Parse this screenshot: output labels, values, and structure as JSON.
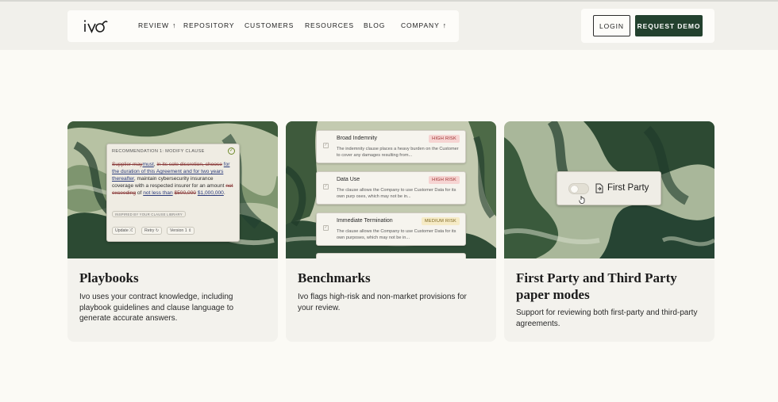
{
  "brand": {
    "logo_text": "ivo"
  },
  "nav": {
    "items": [
      {
        "label": "REVIEW",
        "has_arrow": true
      },
      {
        "label": "REPOSITORY",
        "has_arrow": false
      },
      {
        "label": "CUSTOMERS",
        "has_arrow": false
      },
      {
        "label": "RESOURCES",
        "has_arrow": false
      },
      {
        "label": "BLOG",
        "has_arrow": false
      },
      {
        "label": "COMPANY",
        "has_arrow": true
      }
    ],
    "arrow_glyph": "↑",
    "login_label": "LOGIN",
    "demo_label": "REQUEST DEMO"
  },
  "colors": {
    "accent_dark_green": "#23412e",
    "page_bg": "#fbfaf5",
    "card_bg": "#f3f2ed",
    "high_risk": "#9b2b2b",
    "medium_risk": "#7a6320"
  },
  "cards": [
    {
      "title": "Playbooks",
      "description": "Ivo uses your contract knowledge, including playbook guidelines and clause language to generate accurate answers.",
      "panel": {
        "heading": "RECOMMENDATION 1: MODIFY CLAUSE",
        "check_icon": "check-circle-icon",
        "body": {
          "t1": "Supplier may",
          "t2": "must",
          "t3": ", ",
          "t4": "in its sole discretion, choose",
          "t5": "for the duration of this Agreement and for two years thereafter",
          "t6": ", maintain cybersecurity insurance coverage with a respected insurer for an amount ",
          "t7": "not exceeding",
          "t8": " of ",
          "t9": "not less than",
          "t10": "$500,000",
          "t11": " ",
          "t12": "$1,000,000",
          "t13": "."
        },
        "tag": "INSPIRED BY YOUR CLAUSE LIBRARY",
        "buttons": [
          "Update ⤮",
          "Retry ↻",
          "Version 1 ⇕"
        ]
      }
    },
    {
      "title": "Benchmarks",
      "description": "Ivo flags high-risk and non-market provisions for your review.",
      "items": [
        {
          "title": "Broad Indemnity",
          "risk": "HIGH RISK",
          "level": "high",
          "text": "The indemnity clause places a heavy burden on the Customer to cover any damages resulting from..."
        },
        {
          "title": "Data Use",
          "risk": "HIGH RISK",
          "level": "high",
          "text": "The clause allows the Company to use Customer Data for its own purp oses, which may not be in..."
        },
        {
          "title": "Immediate Termination",
          "risk": "MEDIUM RISK",
          "level": "medium",
          "text": "The clause allows the Company to use Customer Data for its own purposes, which may not be in..."
        }
      ],
      "check_glyph": "✓"
    },
    {
      "title": "First Party and Third Party paper modes",
      "description": "Support for reviewing both first-party and third-party agreements.",
      "toggle_label": "First Party",
      "toggle_on": false
    }
  ]
}
